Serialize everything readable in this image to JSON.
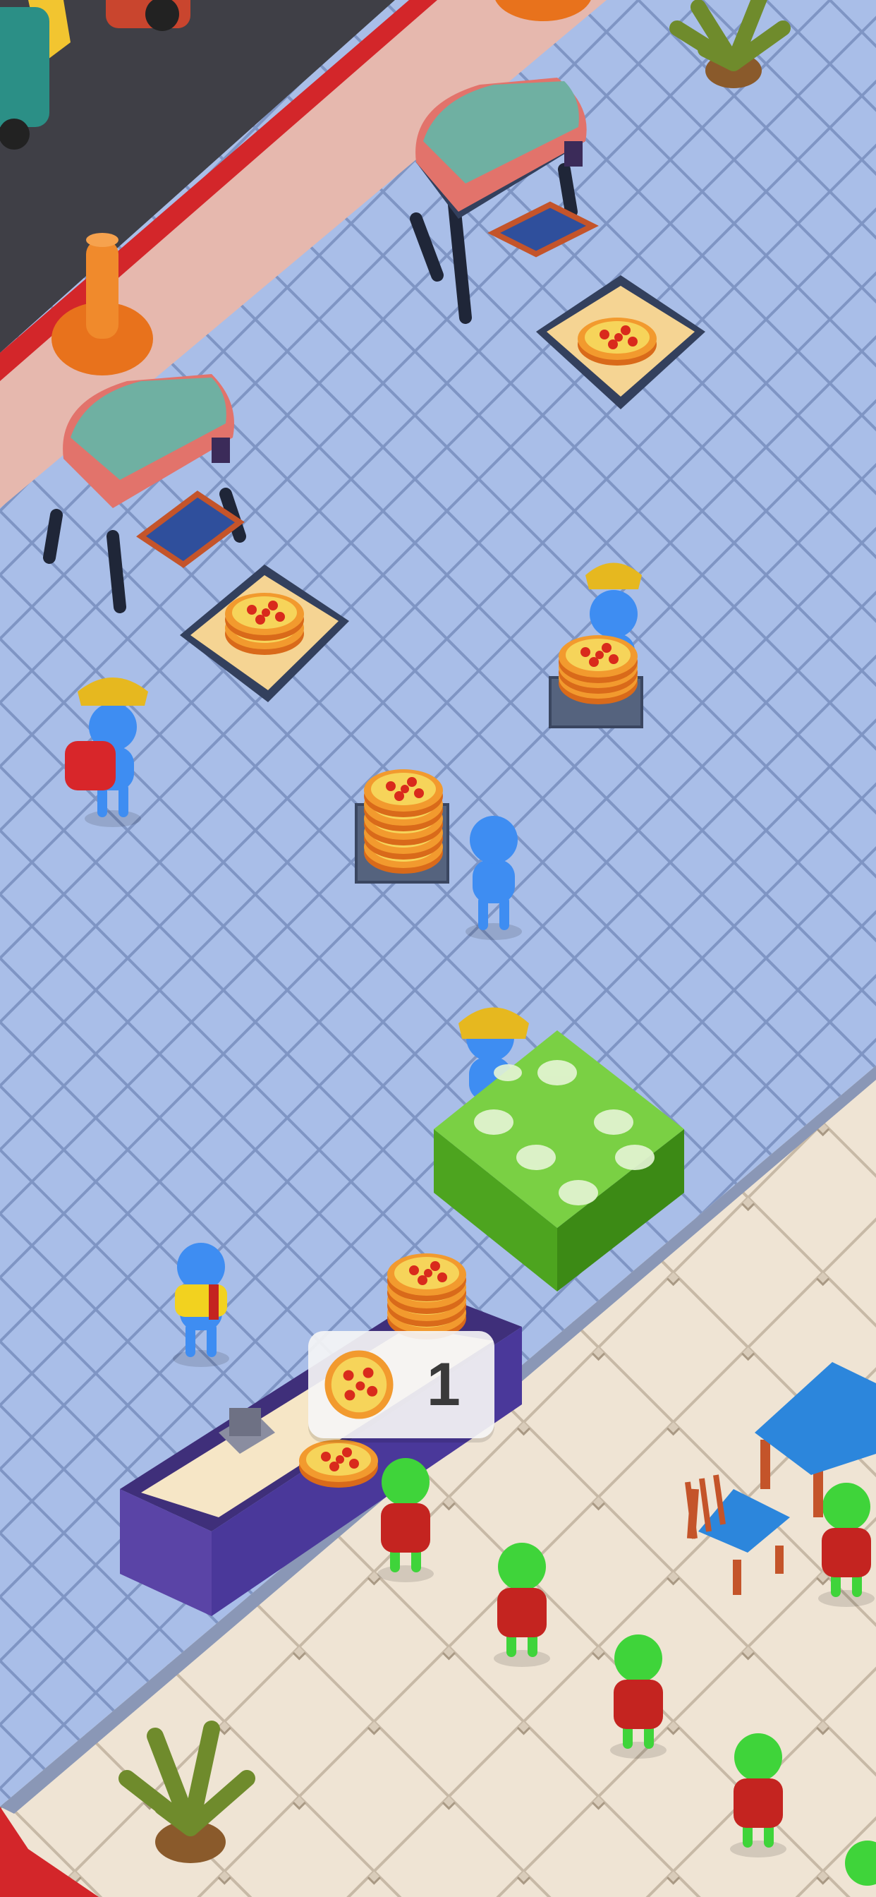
{
  "game": {
    "order_bubble": {
      "item_icon": "pizza-icon",
      "count": "1"
    }
  },
  "colors": {
    "kitchen_floor": "#a8bde6",
    "dining_floor": "#efe4d4",
    "cash_stack": "#5fc02a",
    "worker_body": "#3e8df2",
    "customer_body": "#3fd43a",
    "counter": "#6c55b8",
    "table_top": "#2c86dc"
  }
}
